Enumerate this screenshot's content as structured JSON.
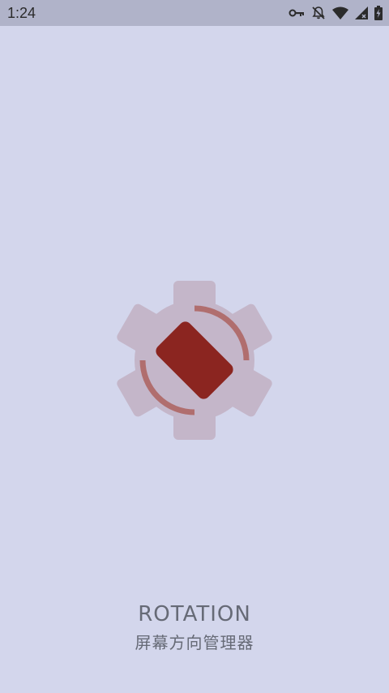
{
  "status_bar": {
    "time": "1:24",
    "icons": [
      "vpn-key-icon",
      "notifications-off-icon",
      "wifi-icon",
      "cell-signal-icon",
      "battery-charging-icon"
    ]
  },
  "splash": {
    "logo_icon": "rotation-gear-logo-icon",
    "app_name": "ROTATION",
    "subtitle": "屏幕方向管理器"
  },
  "colors": {
    "background": "#d3d6ec",
    "status_bar": "#b0b3c9",
    "gear": "#c4b6c9",
    "phone": "#8b2520",
    "arrows": "#b06e6e",
    "text": "#666a76"
  }
}
